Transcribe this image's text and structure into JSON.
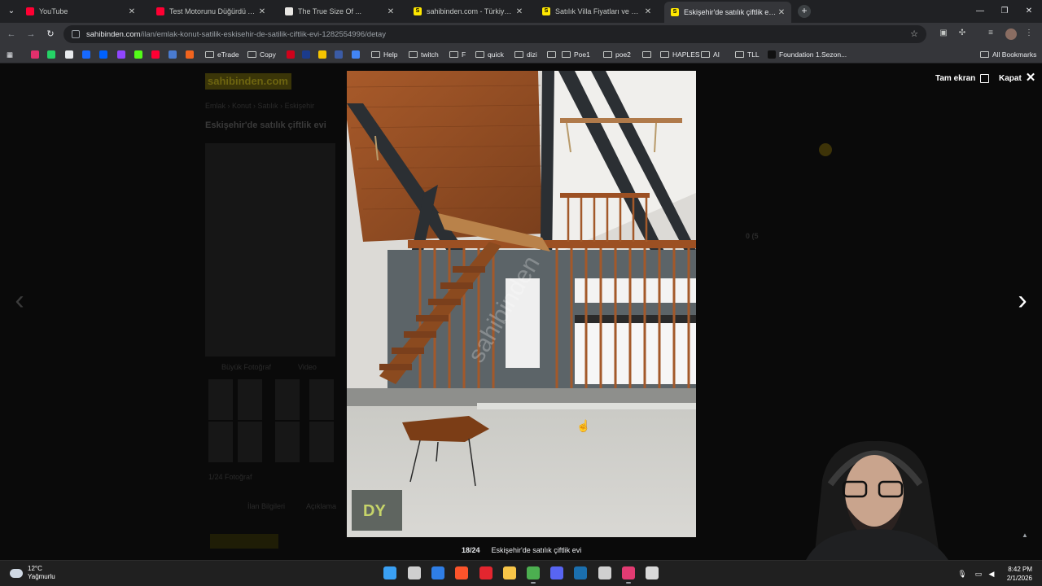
{
  "browser": {
    "tabs": [
      {
        "title": "YouTube",
        "favicon_color": "#ff0033",
        "active": false
      },
      {
        "title": "Test Motorunu Düğürdü Ama...",
        "favicon_color": "#ff0033",
        "active": false
      },
      {
        "title": "The True Size Of ...",
        "favicon_color": "#e8e6e3",
        "active": false
      },
      {
        "title": "sahibinden.com - Türkiye'nin O...",
        "favicon_color": "#ffe800",
        "active": false
      },
      {
        "title": "Satılık Villa Fiyatları ve Villa İlan...",
        "favicon_color": "#ffe800",
        "active": false
      },
      {
        "title": "Eskişehir'de satılık çiftlik evi - S...",
        "favicon_color": "#ffe800",
        "active": true
      }
    ],
    "favicon_letter": "S",
    "url_host": "sahibinden.com",
    "url_path": "/ilan/emlak-konut-satilik-eskisehir-de-satilik-ciftlik-evi-1282554996/detay",
    "bookmarks": [
      {
        "label": "",
        "type": "instagram-icon",
        "color": "#e1306c"
      },
      {
        "label": "",
        "type": "whatsapp-icon",
        "color": "#25d366"
      },
      {
        "label": "",
        "type": "x-icon",
        "color": "#e8eaed"
      },
      {
        "label": "",
        "type": "behance-icon",
        "color": "#1769ff"
      },
      {
        "label": "",
        "type": "dropbox-icon",
        "color": "#0061fe"
      },
      {
        "label": "",
        "type": "twitch-icon",
        "color": "#9146ff"
      },
      {
        "label": "",
        "type": "kick-icon",
        "color": "#53fc18"
      },
      {
        "label": "",
        "type": "youtube-icon",
        "color": "#ff0033"
      },
      {
        "label": "",
        "type": "browser-icon",
        "color": "#4a7bd0"
      },
      {
        "label": "",
        "type": "etsy-icon",
        "color": "#f1641e"
      },
      {
        "label": "eTrade",
        "type": "folder"
      },
      {
        "label": "Copy",
        "type": "folder"
      },
      {
        "label": "",
        "type": "red-app-icon",
        "color": "#d0021b"
      },
      {
        "label": "",
        "type": "b-app-icon",
        "color": "#1b3b8b"
      },
      {
        "label": "",
        "type": "yellow-app-icon",
        "color": "#f5c400"
      },
      {
        "label": "",
        "type": "dark-app-icon",
        "color": "#3b5ba5"
      },
      {
        "label": "",
        "type": "translate-icon",
        "color": "#4285f4"
      },
      {
        "label": "Help",
        "type": "folder"
      },
      {
        "label": "twitch",
        "type": "folder"
      },
      {
        "label": "F",
        "type": "folder"
      },
      {
        "label": "quick",
        "type": "folder"
      },
      {
        "label": "dizi",
        "type": "folder"
      },
      {
        "label": "",
        "type": "folder"
      },
      {
        "label": "Poe1",
        "type": "folder"
      },
      {
        "label": "poe2",
        "type": "folder"
      },
      {
        "label": "",
        "type": "folder"
      },
      {
        "label": "HAPLES",
        "type": "folder"
      },
      {
        "label": "AI",
        "type": "folder"
      },
      {
        "label": "TLL",
        "type": "folder"
      },
      {
        "label": "Foundation 1.Sezon...",
        "type": "page",
        "color": "#111"
      }
    ],
    "all_bookmarks": "All Bookmarks"
  },
  "page": {
    "logo": "sahibinden.com",
    "listing_title": "Eskişehir'de satılık çiftlik evi",
    "ghost_links": [
      "Emlak",
      "Konut",
      "Satılık",
      "Eskişehir"
    ],
    "ghost_buttons": [
      "Büyük Fotoğraf",
      "Video"
    ],
    "ghost_count": "1/24 Fotoğraf",
    "ghost_phone": "0 (5",
    "ghost_tabs": [
      "İlan Bilgileri",
      "Açıklama"
    ]
  },
  "gallery": {
    "fullscreen_label": "Tam ekran",
    "close_label": "Kapat",
    "counter": "18/24",
    "caption": "Eskişehir'de satılık çiftlik evi",
    "watermark": "sahibinden",
    "logo_text": "DY"
  },
  "taskbar": {
    "temperature": "12°C",
    "weather": "Yağmurlu",
    "time": "8:42 PM",
    "date": "2/1/2026",
    "apps": [
      {
        "name": "start-button",
        "color": "#3aa0f3"
      },
      {
        "name": "task-view-button",
        "color": "#cfcfcf"
      },
      {
        "name": "todo-app",
        "color": "#2f7ee6"
      },
      {
        "name": "brave-app",
        "color": "#fb542b"
      },
      {
        "name": "opera-app",
        "color": "#e3262f"
      },
      {
        "name": "file-explorer-app",
        "color": "#f7c548"
      },
      {
        "name": "chrome-app",
        "color": "#4caf50"
      },
      {
        "name": "discord-app",
        "color": "#5865f2"
      },
      {
        "name": "steam-app",
        "color": "#1b6fae"
      },
      {
        "name": "settings-app",
        "color": "#d0d0d0"
      },
      {
        "name": "streaming-app",
        "color": "#e23b72"
      },
      {
        "name": "obs-app",
        "color": "#d9d9d9"
      }
    ]
  }
}
